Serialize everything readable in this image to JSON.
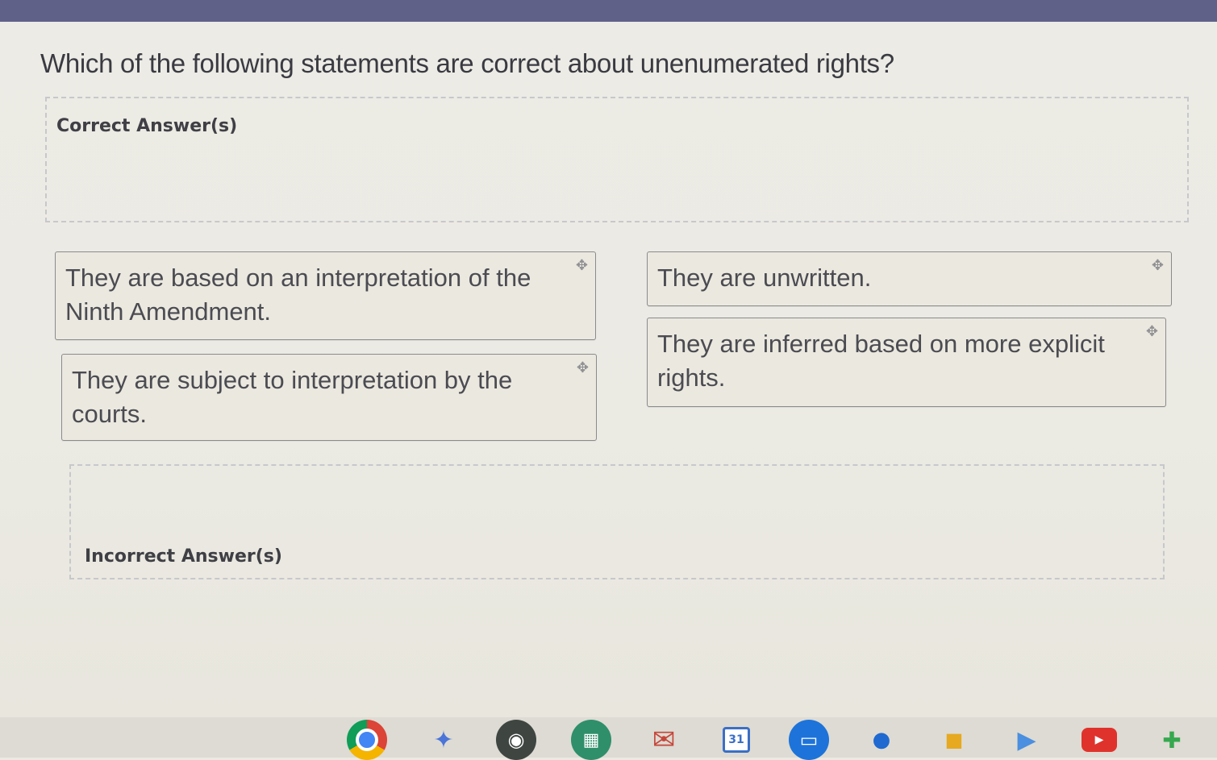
{
  "question": {
    "text": "Which of the following statements are correct about unenumerated rights?"
  },
  "zones": {
    "correct_label": "Correct Answer(s)",
    "incorrect_label": "Incorrect Answer(s)"
  },
  "answer_cards": [
    {
      "text": "They are based on an interpretation of the Ninth Amendment."
    },
    {
      "text": "They are subject to interpretation by the courts."
    },
    {
      "text": "They are unwritten."
    },
    {
      "text": "They are inferred based on more explicit rights."
    }
  ],
  "drag_handle_glyph": "✥",
  "shelf": {
    "apps": [
      "chrome-icon",
      "gemini-icon",
      "podcast-icon",
      "apps-launcher-icon",
      "gmail-icon",
      "calendar-icon",
      "files-icon",
      "chat-icon",
      "meet-icon",
      "play-store-icon",
      "youtube-icon",
      "slack-icon"
    ],
    "calendar_day": "31"
  },
  "colors": {
    "top_bar": "#5f6189",
    "page_background": "#ebe9e1",
    "card_border": "#8a8a8e",
    "text": "#4b4b52"
  }
}
